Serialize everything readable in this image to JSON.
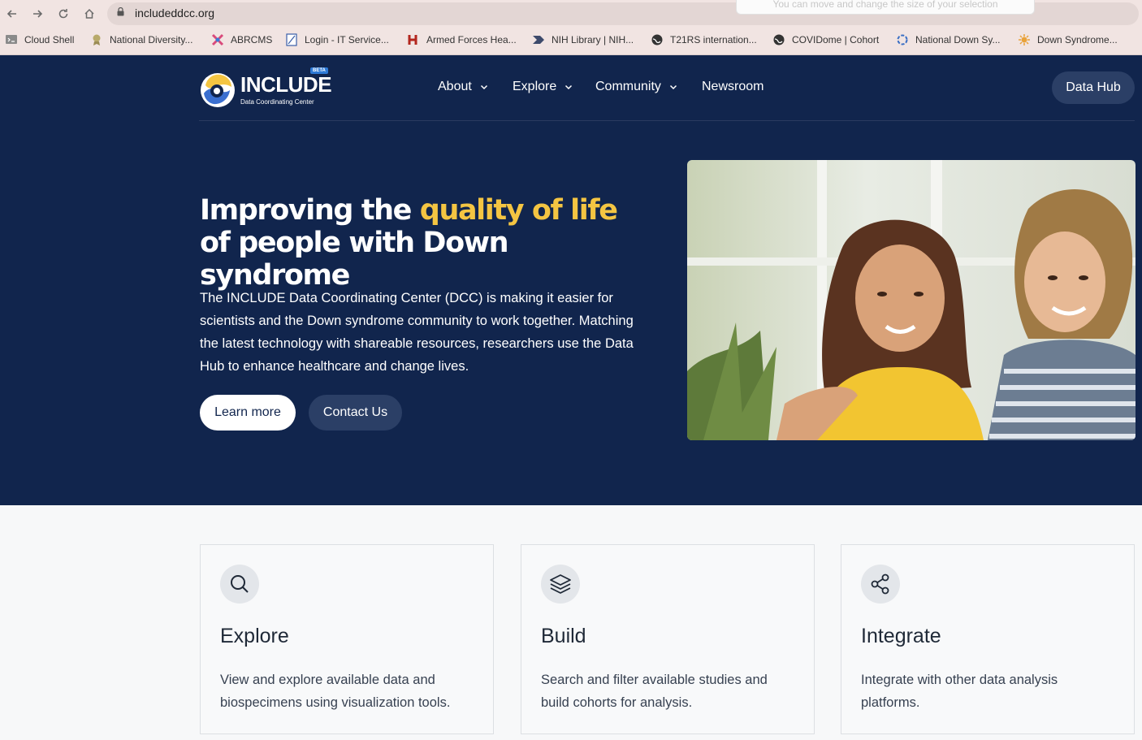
{
  "browser": {
    "url": "includeddcc.org",
    "overlay_tip": "You can move and change the size of your selection",
    "bookmarks": [
      {
        "label": "Cloud Shell",
        "icon": "terminal-icon"
      },
      {
        "label": "National Diversity...",
        "icon": "award-icon"
      },
      {
        "label": "ABRCMS",
        "icon": "puzzle-icon"
      },
      {
        "label": "Login - IT Service...",
        "icon": "document-icon"
      },
      {
        "label": "Armed Forces Hea...",
        "icon": "h-logo-icon"
      },
      {
        "label": "NIH Library | NIH...",
        "icon": "nih-icon"
      },
      {
        "label": "T21RS internation...",
        "icon": "globe-icon"
      },
      {
        "label": "COVIDome | Cohort",
        "icon": "globe-icon"
      },
      {
        "label": "National Down Sy...",
        "icon": "spinner-icon"
      },
      {
        "label": "Down Syndrome...",
        "icon": "sun-icon"
      }
    ]
  },
  "site": {
    "logo_text": "INCLUDE",
    "logo_sub": "Data Coordinating Center",
    "logo_badge": "BETA",
    "nav": [
      {
        "label": "About",
        "has_dropdown": true
      },
      {
        "label": "Explore",
        "has_dropdown": true
      },
      {
        "label": "Community",
        "has_dropdown": true
      },
      {
        "label": "Newsroom",
        "has_dropdown": false
      }
    ],
    "cta": "Data Hub"
  },
  "hero": {
    "headline_pre": "Improving the ",
    "headline_highlight": "quality of life",
    "headline_post": " of people with Down syndrome",
    "intro": "The INCLUDE Data Coordinating Center (DCC) is making it easier for scientists and the Down syndrome community to work together. Matching the latest technology with shareable resources, researchers use the Data Hub to enhance healthcare and change lives.",
    "learn_more": "Learn more",
    "contact": "Contact Us"
  },
  "features": [
    {
      "title": "Explore",
      "desc": "View and explore available data and biospecimens using visualization tools.",
      "icon": "search-icon"
    },
    {
      "title": "Build",
      "desc": "Search and filter available studies and build cohorts for analysis.",
      "icon": "layers-icon"
    },
    {
      "title": "Integrate",
      "desc": "Integrate with other data analysis platforms.",
      "icon": "share-icon"
    }
  ],
  "colors": {
    "navy": "#11254d",
    "highlight": "#f4c542",
    "button_dark": "#2b3f66"
  }
}
